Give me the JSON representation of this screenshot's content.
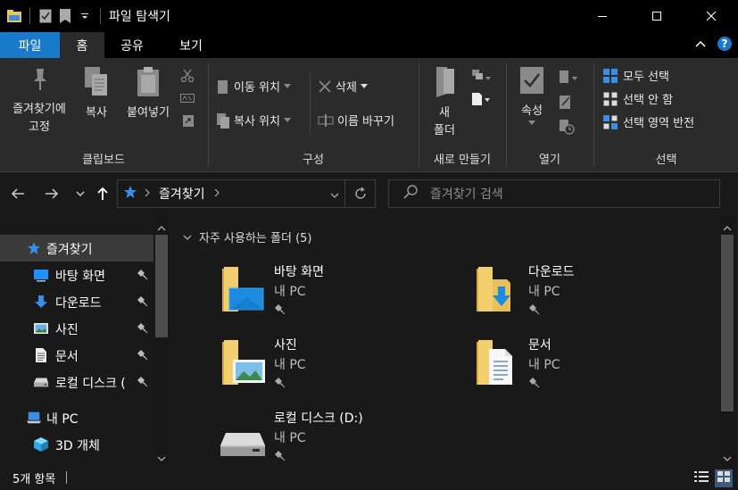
{
  "window": {
    "title": "파일 탐색기"
  },
  "ribbon_tabs": [
    "파일",
    "홈",
    "공유",
    "보기"
  ],
  "ribbon": {
    "clipboard": {
      "label": "클립보드",
      "pin_label_line1": "즐겨찾기에",
      "pin_label_line2": "고정",
      "copy_label": "복사",
      "paste_label": "붙여넣기"
    },
    "organize": {
      "label": "구성",
      "move_to": "이동 위치",
      "copy_to": "복사 위치",
      "delete": "삭제",
      "rename": "이름 바꾸기"
    },
    "new": {
      "label": "새로 만들기",
      "new_folder_line1": "새",
      "new_folder_line2": "폴더"
    },
    "open": {
      "label": "열기",
      "properties": "속성"
    },
    "select": {
      "label": "선택",
      "select_all": "모두 선택",
      "select_none": "선택 안 함",
      "invert": "선택 영역 반전"
    }
  },
  "address": {
    "path": "즐겨찾기",
    "search_placeholder": "즐겨찾기 검색"
  },
  "nav_pane": {
    "items": [
      {
        "label": "즐겨찾기",
        "icon": "star-icon"
      },
      {
        "label": "바탕 화면",
        "icon": "desktop-icon",
        "pinned": true
      },
      {
        "label": "다운로드",
        "icon": "download-icon",
        "pinned": true
      },
      {
        "label": "사진",
        "icon": "pictures-icon",
        "pinned": true
      },
      {
        "label": "문서",
        "icon": "documents-icon",
        "pinned": true
      },
      {
        "label": "로컬 디스크 (",
        "icon": "drive-icon",
        "pinned": true
      },
      {
        "label": "내 PC",
        "icon": "pc-icon"
      },
      {
        "label": "3D 개체",
        "icon": "3d-objects-icon"
      }
    ]
  },
  "content": {
    "group_header": "자주 사용하는 폴더 (5)",
    "tiles": [
      {
        "name": "바탕 화면",
        "location": "내 PC",
        "icon": "desktop-folder-icon"
      },
      {
        "name": "다운로드",
        "location": "내 PC",
        "icon": "downloads-folder-icon"
      },
      {
        "name": "사진",
        "location": "내 PC",
        "icon": "pictures-folder-icon"
      },
      {
        "name": "문서",
        "location": "내 PC",
        "icon": "documents-folder-icon"
      },
      {
        "name": "로컬 디스크 (D:)",
        "location": "내 PC",
        "icon": "drive-icon"
      }
    ]
  },
  "status": {
    "item_count": "5개 항목"
  },
  "colors": {
    "accent": "#1979ca",
    "folder": "#e8c160",
    "background": "#191919",
    "ribbon": "#2b2b2b"
  }
}
